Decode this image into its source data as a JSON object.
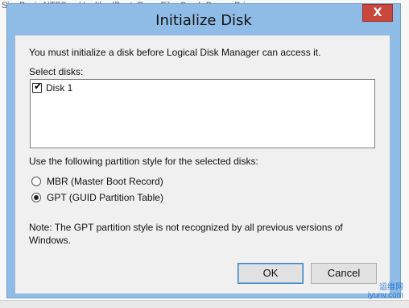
{
  "background": {
    "top_text": "Si... Basic NTFS ... Healthy (Boot, Page File, Crash Dump, Primar"
  },
  "dialog": {
    "title": "Initialize Disk",
    "close_symbol": "X",
    "message": "You must initialize a disk before Logical Disk Manager can access it.",
    "select_disks_label": "Select disks:",
    "disks": [
      {
        "label": "Disk 1",
        "checked": true
      }
    ],
    "partition_style_label": "Use the following partition style for the selected disks:",
    "options": [
      {
        "label": "MBR (Master Boot Record)",
        "selected": false
      },
      {
        "label": "GPT (GUID Partition Table)",
        "selected": true
      }
    ],
    "note_line1": "Note: The GPT partition style is not recognized by all previous versions of",
    "note_line2": "Windows.",
    "ok_label": "OK",
    "cancel_label": "Cancel"
  },
  "watermark": {
    "line1": "运维网",
    "line2": "iyunv.com"
  },
  "colors": {
    "titlebar": "#8fbce6",
    "close_button": "#c9473d",
    "content_background": "#f0f0f0"
  }
}
